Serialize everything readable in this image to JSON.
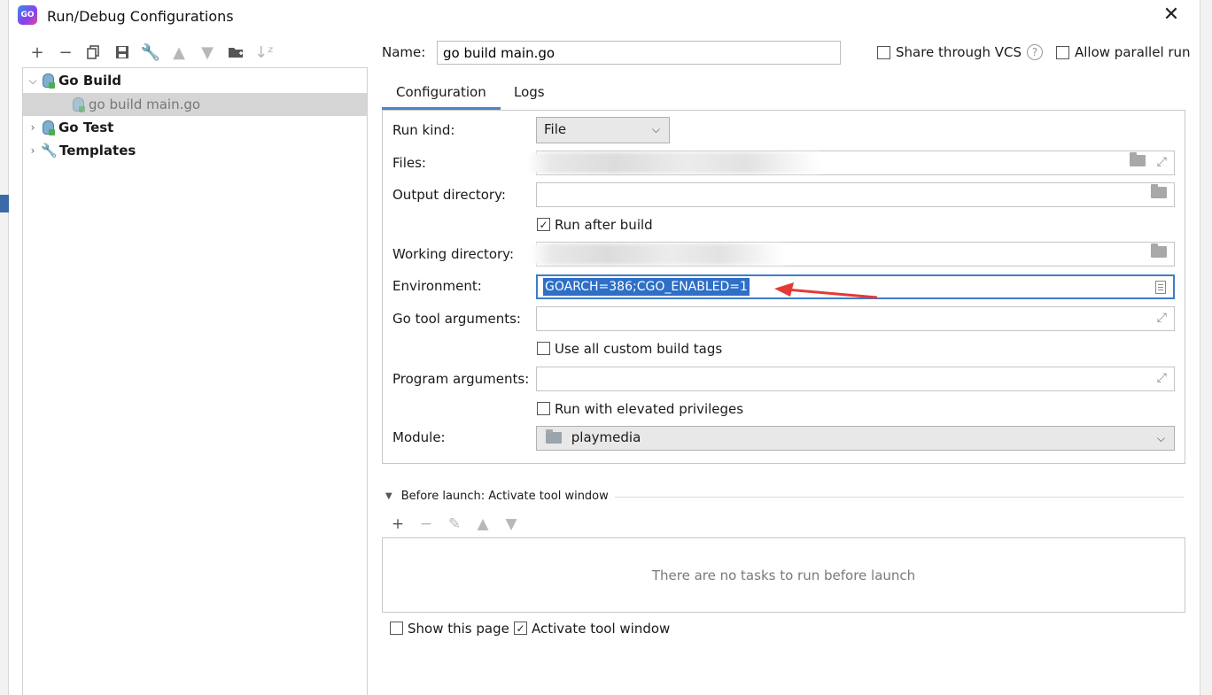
{
  "window": {
    "title": "Run/Debug Configurations",
    "app_icon_text": "GO"
  },
  "left_toolbar": {
    "icons": [
      "add-icon",
      "remove-icon",
      "copy-icon",
      "save-icon",
      "wrench-icon",
      "move-up-icon",
      "move-down-icon",
      "new-folder-icon",
      "sort-icon"
    ]
  },
  "tree": {
    "items": [
      {
        "label": "Go Build",
        "expanded": true
      },
      {
        "label": "go build main.go",
        "selected": true
      },
      {
        "label": "Go Test",
        "expanded": false
      },
      {
        "label": "Templates",
        "expanded": false
      }
    ]
  },
  "header": {
    "name_label": "Name:",
    "name_value": "go build main.go",
    "share_vcs_label": "Share through VCS",
    "share_vcs_checked": false,
    "help_symbol": "?",
    "allow_parallel_label": "Allow parallel run",
    "allow_parallel_checked": false
  },
  "tabs": [
    {
      "label": "Configuration",
      "active": true
    },
    {
      "label": "Logs",
      "active": false
    }
  ],
  "form": {
    "run_kind_label": "Run kind:",
    "run_kind_value": "File",
    "files_label": "Files:",
    "output_dir_label": "Output directory:",
    "run_after_build_label": "Run after build",
    "run_after_build_checked": true,
    "working_dir_label": "Working directory:",
    "environment_label": "Environment:",
    "environment_value": "GOARCH=386;CGO_ENABLED=1",
    "go_tool_args_label": "Go tool arguments:",
    "custom_tags_label": "Use all custom build tags",
    "custom_tags_checked": false,
    "program_args_label": "Program arguments:",
    "elevated_label": "Run with elevated privileges",
    "elevated_checked": false,
    "module_label": "Module:",
    "module_value": "playmedia"
  },
  "before_launch": {
    "title": "Before launch: Activate tool window",
    "empty_text": "There are no tasks to run before launch"
  },
  "footer": {
    "show_page_label": "Show this page",
    "show_page_checked": false,
    "activate_tool_label": "Activate tool window",
    "activate_tool_checked": true
  },
  "colors": {
    "selection_blue": "#2e6fc7",
    "tab_underline": "#4a86c8",
    "annotation_arrow": "#e53935"
  }
}
